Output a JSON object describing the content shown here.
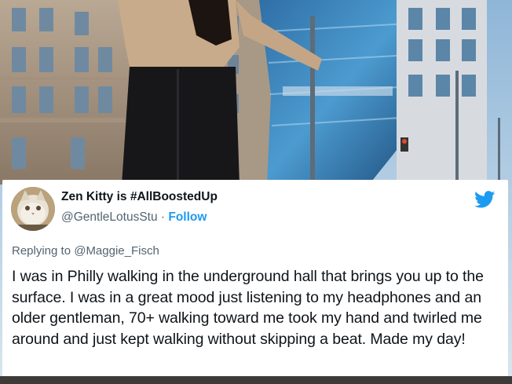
{
  "tweet": {
    "display_name": "Zen Kitty is #AllBoostedUp",
    "handle": "@GentleLotusStu",
    "separator": " · ",
    "follow_label": "Follow",
    "replying_to": "Replying to @Maggie_Fisch",
    "body": "I was in Philly walking in the underground hall that brings you up to the surface. I was in a great mood just listening to my headphones and an older gentleman, 70+ walking toward me took my hand and twirled me around and just kept walking without skipping a beat. Made my day!"
  },
  "icons": {
    "brand": "twitter-bird-icon",
    "avatar": "cat-avatar"
  },
  "colors": {
    "accent": "#1d9bf0",
    "text": "#0f1419",
    "muted": "#536471"
  }
}
